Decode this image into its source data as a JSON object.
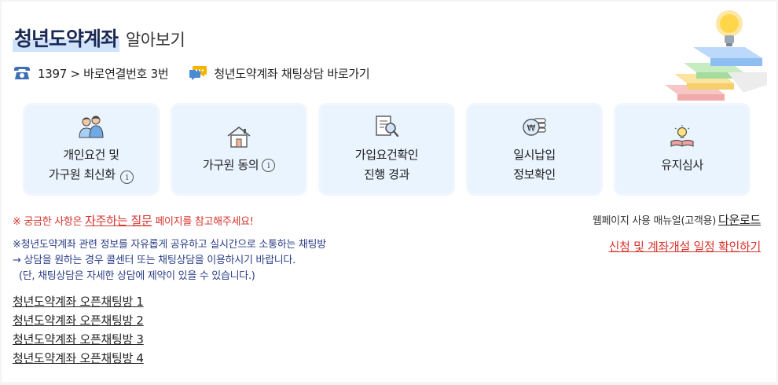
{
  "header": {
    "title_main": "청년도약계좌",
    "title_sub": "알아보기"
  },
  "contact": {
    "phone_text": "1397 > 바로연결번호 3번",
    "chat_text": "청년도약계좌 채팅상담 바로가기"
  },
  "cards": [
    {
      "lines": [
        "개인요건 및",
        "가구원 최신화"
      ],
      "info": true,
      "icon": "family-icon"
    },
    {
      "lines": [
        "가구원 동의"
      ],
      "info": true,
      "icon": "house-icon"
    },
    {
      "lines": [
        "가입요건확인",
        "진행 경과"
      ],
      "info": false,
      "icon": "document-search-icon"
    },
    {
      "lines": [
        "일시납입",
        "정보확인"
      ],
      "info": false,
      "icon": "won-coins-icon"
    },
    {
      "lines": [
        "유지심사"
      ],
      "info": false,
      "icon": "lightbulb-book-icon"
    }
  ],
  "info_glyph": "i",
  "faq": {
    "prefix": "※ 궁금한 사항은 ",
    "link": "자주하는 질문",
    "suffix": " 페이지를 참고해주세요!"
  },
  "manual": {
    "text": "웹페이지 사용 매뉴얼(고객용)",
    "link": "다운로드"
  },
  "schedule_link": "신청 및 계좌개설 일정 확인하기",
  "notice": {
    "line1": "※청년도약계좌 관련 정보를 자유롭게 공유하고 실시간으로 소통하는 채팅방",
    "line2": "→ 상담을 원하는 경우 콜센터 또는 채팅상담을 이용하시기 바랍니다.",
    "line3": "(단, 채팅상담은 자세한 상담에 제약이 있을 수 있습니다.)"
  },
  "chat_rooms": [
    "청년도약계좌 오픈채팅방 1",
    "청년도약계좌 오픈채팅방 2",
    "청년도약계좌 오픈채팅방 3",
    "청년도약계좌 오픈채팅방 4"
  ],
  "colors": {
    "title": "#1b2a55",
    "card_bg": "#eaf4fe",
    "accent_red": "#d8322c",
    "notice_blue": "#2b3e86"
  }
}
